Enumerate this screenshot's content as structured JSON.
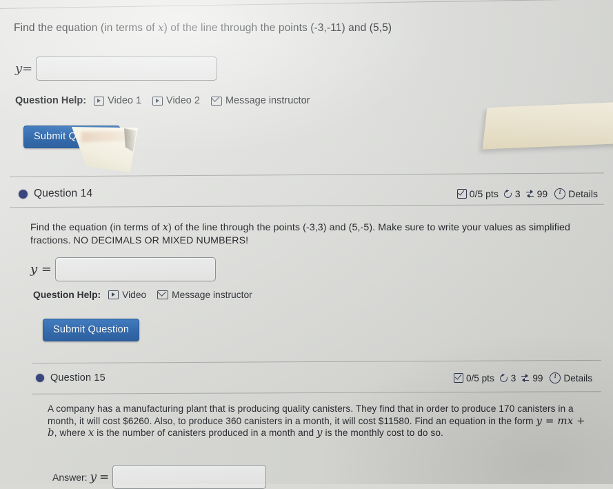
{
  "page": {
    "background_color": "#e3e4e1",
    "accent_button_color": "#2a64ab",
    "bullet_color": "#2f3c78"
  },
  "question_13": {
    "prompt_prefix": "Find the equation (in terms of ",
    "prompt_var": "x",
    "prompt_suffix": ") of the line through the points (-3,-11) and (5,5)",
    "answer": {
      "label_var": "y",
      "label_eq": "=",
      "value": "",
      "placeholder": ""
    },
    "help": {
      "label": "Question Help:",
      "links": [
        {
          "icon": "video-icon",
          "label": "Video 1"
        },
        {
          "icon": "video-icon",
          "label": "Video 2"
        },
        {
          "icon": "mail-icon",
          "label": "Message instructor"
        }
      ]
    },
    "submit_label": "Submit Question"
  },
  "question_14": {
    "header": {
      "title": "Question 14",
      "points": "0/5 pts",
      "attempts": "3",
      "swaps": "99",
      "details_label": "Details"
    },
    "prompt_line1_a": "Find the equation (in terms of ",
    "prompt_var": "x",
    "prompt_line1_b": ") of the line through the points (-3,3) and (5,-5). Make sure to write your",
    "prompt_line2": "values as simplified fractions. NO DECIMALS OR MIXED NUMBERS!",
    "answer": {
      "label_var": "y",
      "label_eq": "=",
      "value": "",
      "placeholder": ""
    },
    "help": {
      "label": "Question Help:",
      "links": [
        {
          "icon": "video-icon",
          "label": "Video"
        },
        {
          "icon": "mail-icon",
          "label": "Message instructor"
        }
      ]
    },
    "submit_label": "Submit Question"
  },
  "question_15": {
    "header": {
      "title": "Question 15",
      "points": "0/5 pts",
      "attempts": "3",
      "swaps": "99",
      "details_label": "Details"
    },
    "prompt_line1": "A company has a manufacturing plant that is producing quality canisters. They find that in order to produce",
    "prompt_line2": "170 canisters in a month, it will cost $6260. Also, to produce 360 canisters in a month, it will cost $11580.",
    "prompt_line3_a": "Find an equation in the form ",
    "prompt_line3_formula": "y = mx + b",
    "prompt_line3_b": ", where ",
    "prompt_line3_var": "x",
    "prompt_line3_c": " is the number of canisters produced in a month and ",
    "prompt_line3_var2": "y",
    "prompt_line4": "is the monthly cost to do so.",
    "answer": {
      "label_text": "Answer:",
      "label_var": "y",
      "label_eq": "=",
      "value": "",
      "placeholder": ""
    }
  },
  "icons": {
    "check_box": "checkbox-check-icon",
    "retry": "retry-circular-arrow-icon",
    "swap": "swap-arrows-icon",
    "info": "info-circle-icon",
    "video": "video-play-icon",
    "mail": "envelope-icon"
  }
}
